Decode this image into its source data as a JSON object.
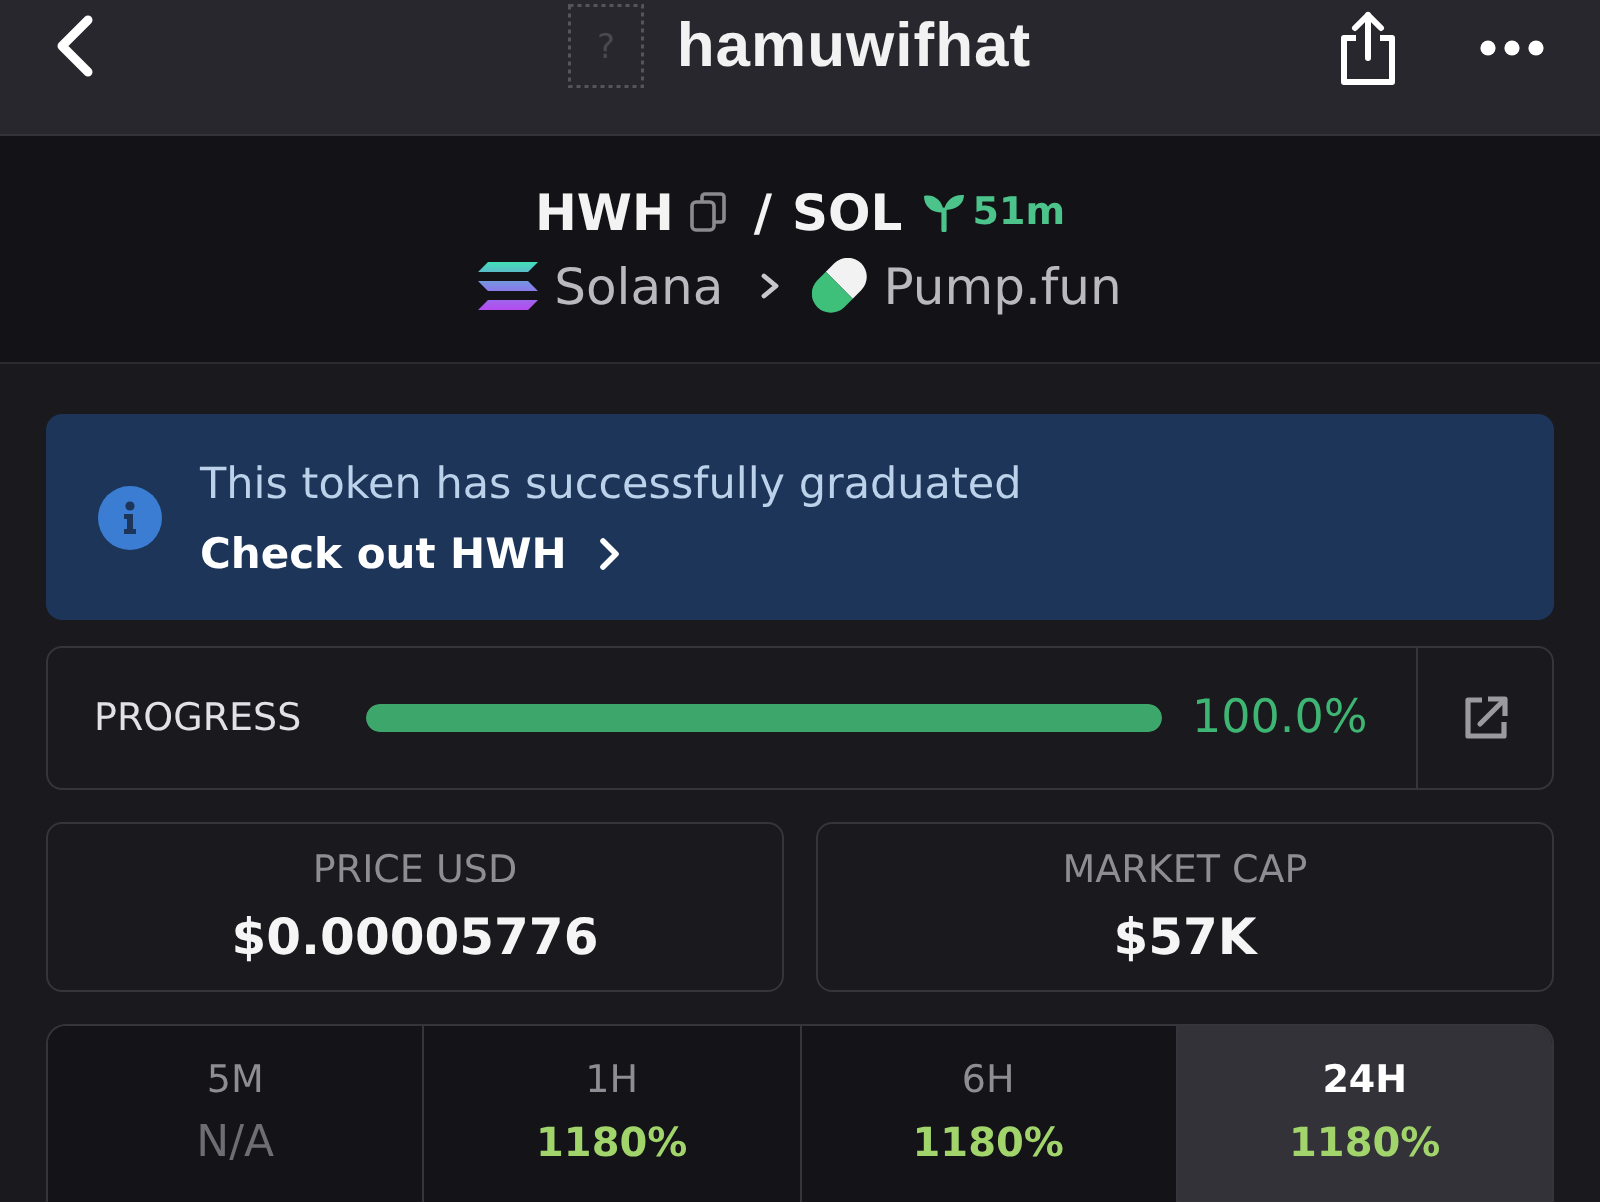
{
  "header": {
    "image_placeholder": "?",
    "title": "hamuwifhat"
  },
  "pair": {
    "base": "HWH",
    "separator": "/",
    "quote": "SOL",
    "age": "51m",
    "chain": "Solana",
    "dex": "Pump.fun"
  },
  "banner": {
    "message": "This token has successfully graduated",
    "link": "Check out HWH"
  },
  "progress": {
    "label": "PROGRESS",
    "level": 1.0,
    "reading": "100.0%"
  },
  "stats": [
    {
      "label": "PRICE USD",
      "value": "$0.00005776"
    },
    {
      "label": "MARKET CAP",
      "value": "$57K"
    }
  ],
  "timeframes": [
    {
      "label": "5M",
      "value": "N/A",
      "kind": "empty",
      "selected": false
    },
    {
      "label": "1H",
      "value": "1180%",
      "kind": "gain",
      "selected": false
    },
    {
      "label": "6H",
      "value": "1180%",
      "kind": "gain",
      "selected": false
    },
    {
      "label": "24H",
      "value": "1180%",
      "kind": "gain",
      "selected": true
    }
  ]
}
